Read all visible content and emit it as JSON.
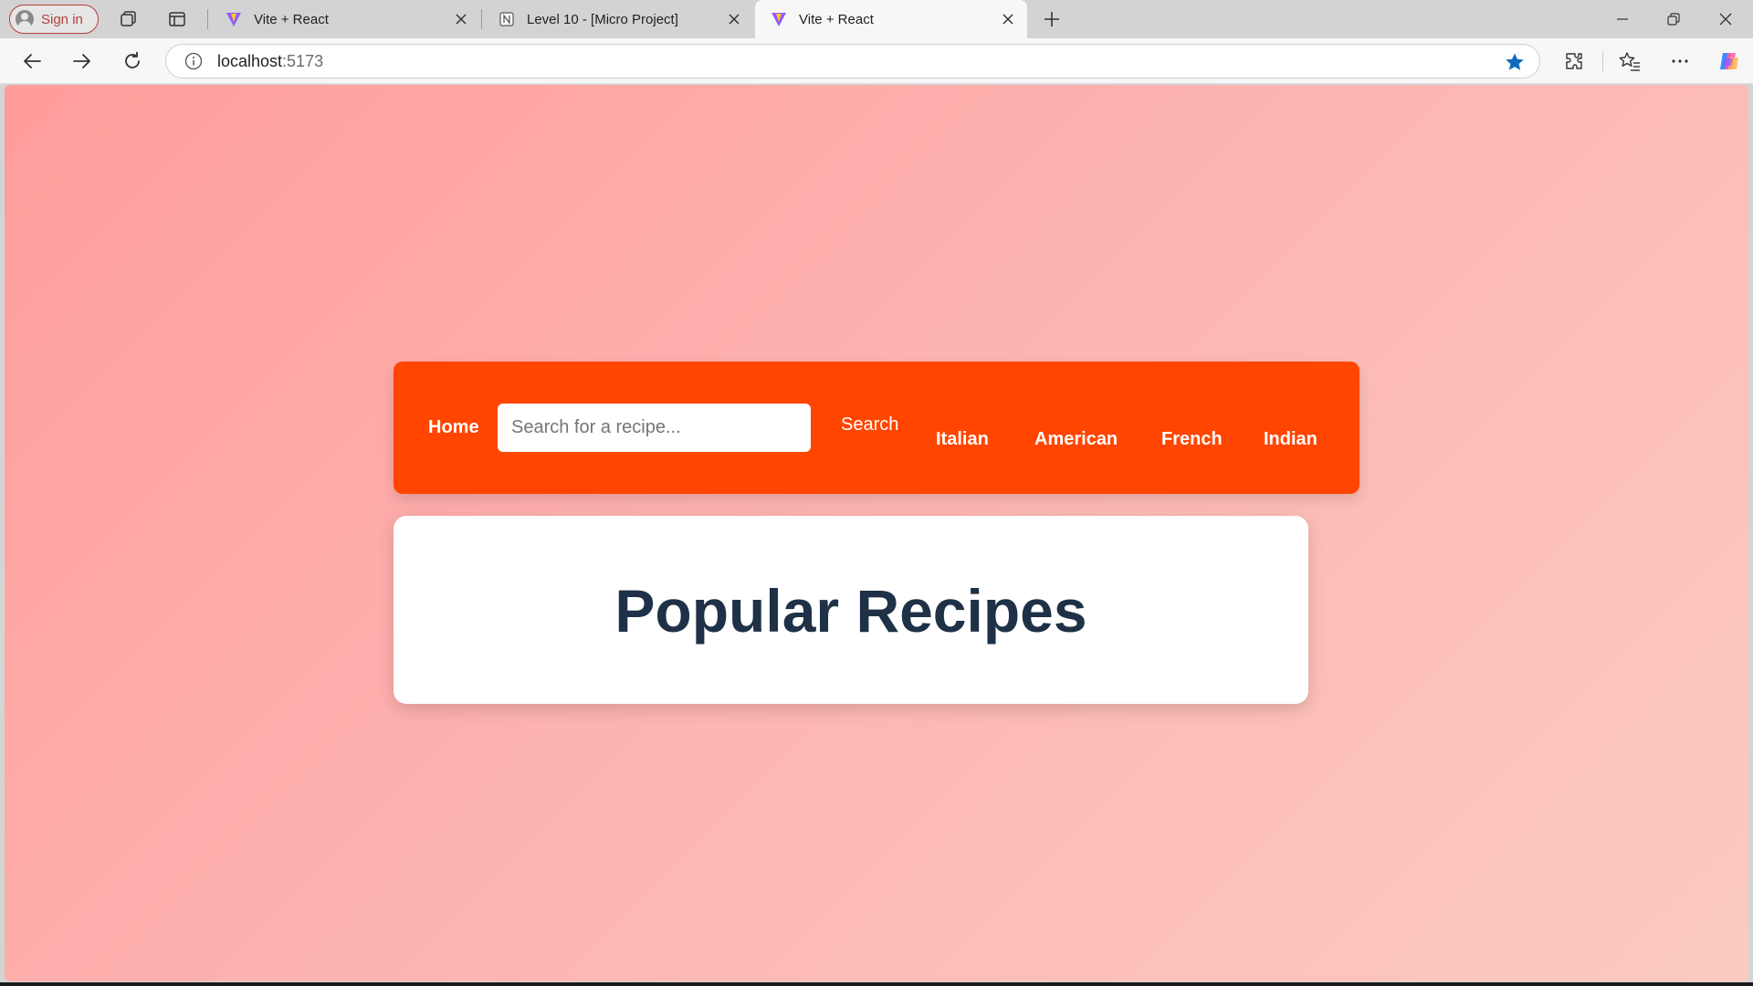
{
  "browser": {
    "sign_in_label": "Sign in",
    "tabs": [
      {
        "title": "Vite + React",
        "favicon": "vite-icon",
        "active": false
      },
      {
        "title": "Level 10 - [Micro Project]",
        "favicon": "notion-icon",
        "active": false
      },
      {
        "title": "Vite + React",
        "favicon": "vite-icon",
        "active": true
      }
    ],
    "address": {
      "host": "localhost",
      "port": ":5173"
    },
    "bookmark_color": "#0f6cbd"
  },
  "page": {
    "navbar": {
      "home_label": "Home",
      "search_placeholder": "Search for a recipe...",
      "search_value": "",
      "search_button_label": "Search",
      "categories": [
        "Italian",
        "American",
        "French",
        "Indian"
      ],
      "accent_color": "#ff4500"
    },
    "heading": "Popular Recipes",
    "heading_color": "#1f3146"
  }
}
